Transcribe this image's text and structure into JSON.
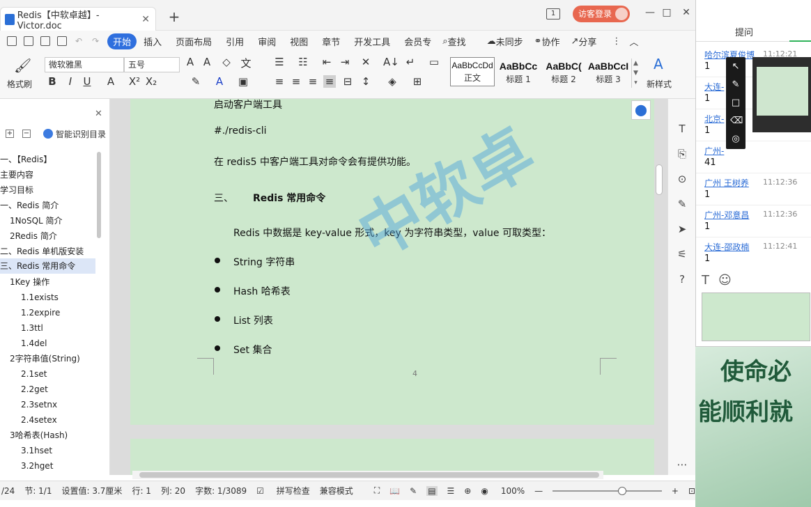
{
  "title_bar": {
    "doc_tab": "Redis【中软卓越】-Victor.doc",
    "new_tab": "+",
    "badge": "1",
    "visitor_login": "访客登录",
    "minimize": "—",
    "maximize": "□",
    "close": "✕"
  },
  "menu": {
    "start": "开始",
    "items": [
      "插入",
      "页面布局",
      "引用",
      "审阅",
      "视图",
      "章节",
      "开发工具",
      "会员专"
    ],
    "search": "查找",
    "sync": "未同步",
    "collab": "协作",
    "share": "分享"
  },
  "ribbon": {
    "format_painter": "格式刷",
    "font_name": "微软雅黑",
    "font_size": "五号",
    "styles": [
      {
        "preview": "AaBbCcDd",
        "name": "正文"
      },
      {
        "preview": "AaBbCc",
        "name": "标题 1"
      },
      {
        "preview": "AaBbC(",
        "name": "标题 2"
      },
      {
        "preview": "AaBbCcI",
        "name": "标题 3"
      }
    ],
    "new_style": "新样式"
  },
  "sidebar": {
    "smart_toc": "智能识别目录",
    "items": [
      "一、【Redis】",
      "主要内容",
      "学习目标",
      "一、Redis 简介",
      "1NoSQL 简介",
      "2Redis 简介",
      "二、Redis 单机版安装",
      "三、Redis 常用命令",
      "1Key 操作",
      "1.1exists",
      "1.2expire",
      "1.3ttl",
      "1.4del",
      "2字符串值(String)",
      "2.1set",
      "2.2get",
      "2.3setnx",
      "2.4setex",
      "3哈希表(Hash)",
      "3.1hset",
      "3.2hget"
    ]
  },
  "document": {
    "line1": "启动客户端工具",
    "line2": "#./redis-cli",
    "line3": "在 redis5 中客户端工具对命令会有提供功能。",
    "heading_num": "三、",
    "heading": "Redis 常用命令",
    "para": "Redis 中数据是 key-value 形式，key 为字符串类型，value 可取类型：",
    "bullets": [
      "String  字符串",
      "Hash  哈希表",
      "List  列表",
      "Set  集合"
    ],
    "page_num": "4",
    "watermark": "中软卓"
  },
  "status": {
    "page": "/24",
    "section": "节: 1/1",
    "setting": "设置值: 3.7厘米",
    "row": "行: 1",
    "col": "列: 20",
    "wordcount": "字数: 1/3089",
    "spellcheck": "拼写检查",
    "compat": "兼容模式",
    "zoom": "100%"
  },
  "chat": {
    "header": "提问",
    "messages": [
      {
        "name": "哈尔滨夏俊博",
        "time": "11:12:21",
        "text": "1"
      },
      {
        "name": "大连-",
        "time": "",
        "text": "1"
      },
      {
        "name": "北京-",
        "time": "",
        "text": "1"
      },
      {
        "name": "广州-",
        "time": "",
        "text": "41"
      },
      {
        "name": "广州 王树养",
        "time": "11:12:36",
        "text": "1"
      },
      {
        "name": "广州-邓意昌",
        "time": "11:12:36",
        "text": "1"
      },
      {
        "name": "大连-邵政楠",
        "time": "11:12:41",
        "text": "1"
      }
    ]
  },
  "desktop": {
    "line1": "使命必",
    "line2": "能顺利就"
  }
}
